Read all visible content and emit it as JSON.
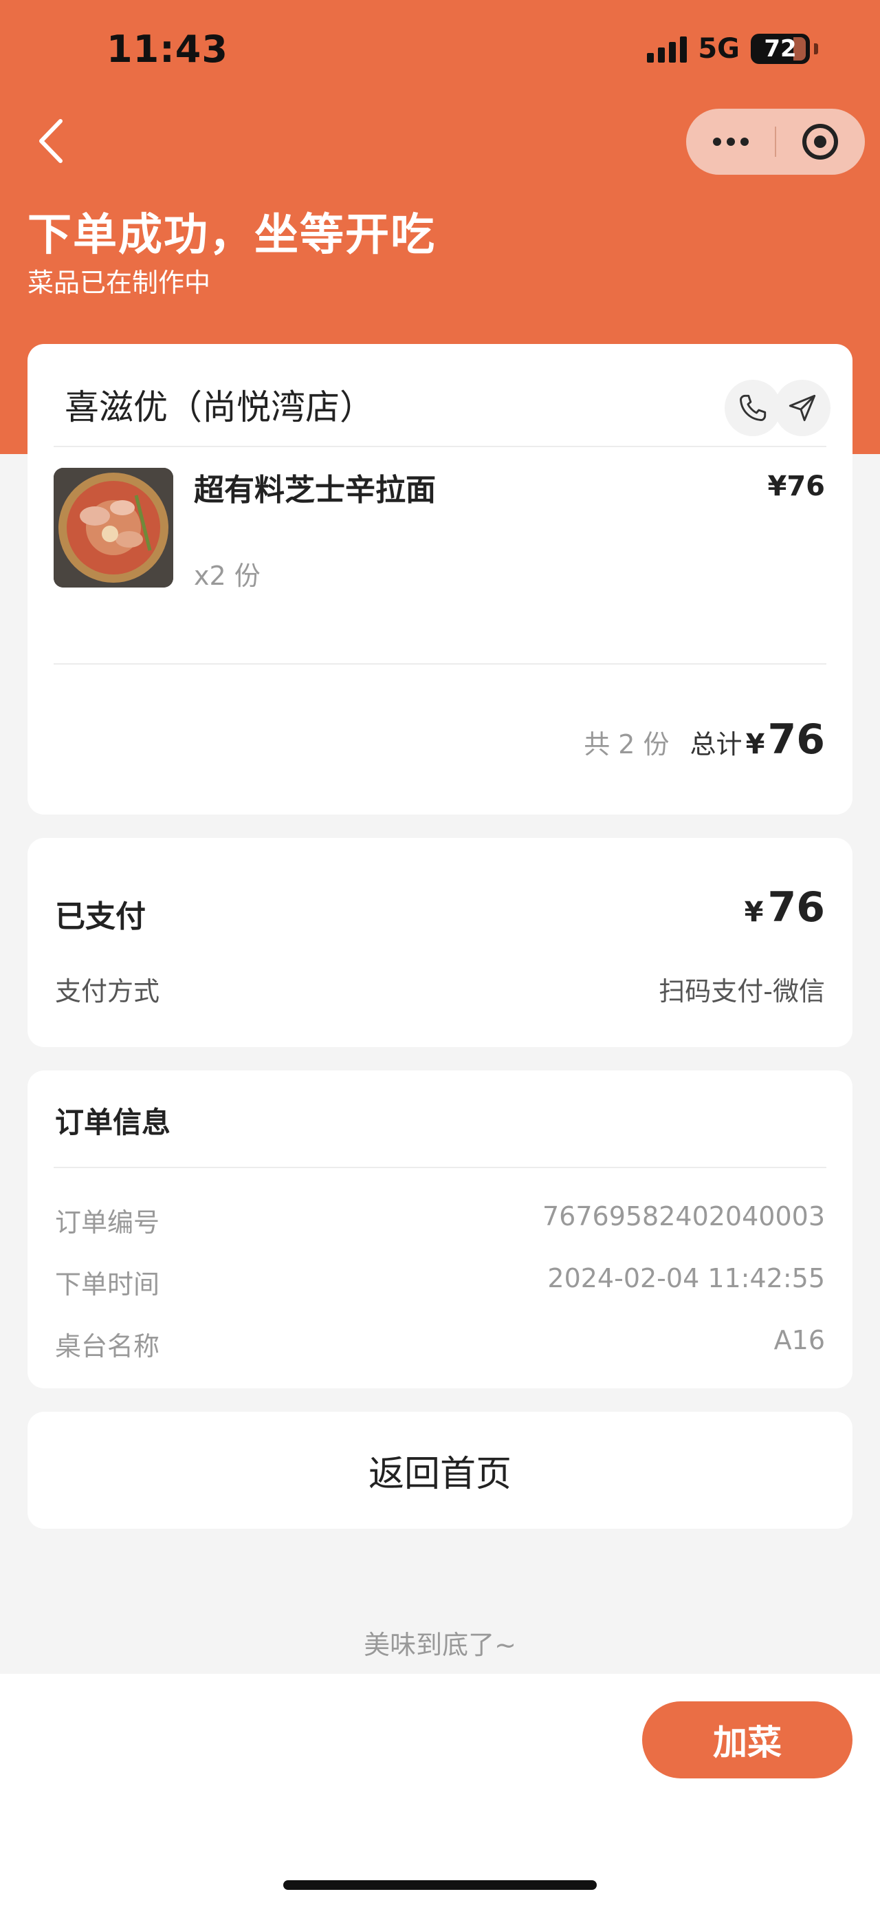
{
  "status_bar": {
    "time": "11:43",
    "network": "5G",
    "battery": "72"
  },
  "header": {
    "title": "下单成功，坐等开吃",
    "subtitle": "菜品已在制作中",
    "back_icon": "chevron-left-icon",
    "more_icon": "more-dots-icon",
    "close_icon": "target-circle-icon"
  },
  "store": {
    "name": "喜滋优（尚悦湾店）",
    "phone_icon": "phone-icon",
    "nav_icon": "navigation-icon",
    "items": [
      {
        "name": "超有料芝士辛拉面",
        "price": "¥76",
        "qty": "x2 份"
      }
    ],
    "count_text": "共 2 份",
    "total_label": "总计",
    "total_currency": "¥",
    "total_amount": "76"
  },
  "payment": {
    "status": "已支付",
    "currency": "¥",
    "amount": "76",
    "method_label": "支付方式",
    "method_value": "扫码支付-微信"
  },
  "order_info": {
    "title": "订单信息",
    "rows": [
      {
        "label": "订单编号",
        "value": "767695824020400​03"
      },
      {
        "label": "下单时间",
        "value": "2024-02-04 11:42:55"
      },
      {
        "label": "桌台名称",
        "value": "A16"
      }
    ]
  },
  "actions": {
    "home_label": "返回首页",
    "add_label": "加菜"
  },
  "footer": {
    "end_text": "美味到底了~"
  },
  "colors": {
    "accent": "#ea6e45",
    "background": "#f4f4f4"
  }
}
